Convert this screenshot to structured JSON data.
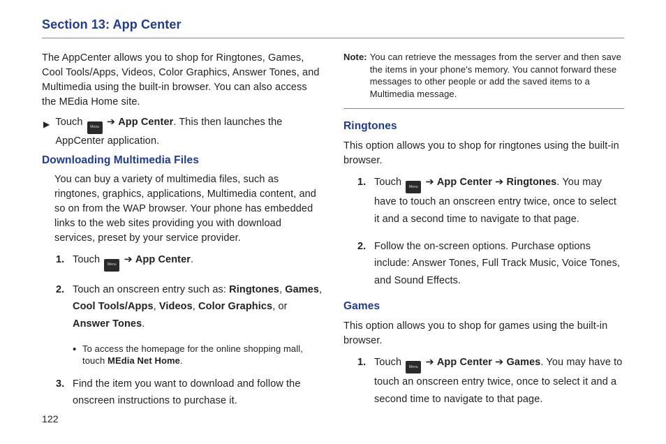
{
  "section_title": "Section 13: App Center",
  "left": {
    "intro": "The AppCenter allows you to shop for Ringtones, Games, Cool Tools/Apps, Videos, Color Graphics, Answer Tones, and Multimedia using the built-in browser. You can also access the MEdia Home site.",
    "touch_prefix": "Touch ",
    "touch_appcenter": "App Center",
    "touch_suffix": ". This then launches the AppCenter application.",
    "h_download": "Downloading Multimedia Files",
    "download_intro": "You can buy a variety of multimedia files, such as ringtones, graphics, applications, Multimedia content, and so on from the WAP browser. Your phone has embedded links to the web sites providing you with download services, preset by your service provider.",
    "step1_pre": "Touch ",
    "step1_appcenter": "App Center",
    "step2_pre": "Touch an onscreen entry such as: ",
    "step2_opts": [
      "Ringtones",
      "Games",
      "Cool Tools/Apps",
      "Videos",
      "Color Graphics",
      "Answer Tones"
    ],
    "step2_bullet_pre": "To access the homepage for the online shopping mall, touch ",
    "step2_bullet_bold": "MEdia Net Home",
    "step3": "Find the item you want to download and follow the onscreen instructions to purchase it."
  },
  "right": {
    "note_label": "Note:",
    "note_body": "You can retrieve the messages from the server and then save the items in your phone's memory. You cannot forward these messages to other people or add the saved items to a Multimedia message.",
    "h_ringtones": "Ringtones",
    "ringtones_intro": "This option allows you to shop for ringtones using the built-in browser.",
    "r_step1_pre": "Touch ",
    "r_step1_mid": "App Center",
    "r_step1_mid2": "Ringtones",
    "r_step1_post": ". You may have to touch an onscreen entry twice, once to select it and a second time to navigate to that page.",
    "r_step2": "Follow the on-screen options. Purchase options include: Answer Tones, Full Track Music, Voice Tones, and Sound Effects.",
    "h_games": "Games",
    "games_intro": "This option allows you to shop for games using the built-in browser.",
    "g_step1_pre": "Touch ",
    "g_step1_mid": "App Center",
    "g_step1_mid2": "Games",
    "g_step1_post": ". You may have to touch an onscreen entry twice, once to select it and a second time to navigate to that page."
  },
  "icon_text": "Menu",
  "arrow": "➔",
  "or_txt": ", or ",
  "comma": ", ",
  "period": ".",
  "page_number": "122"
}
